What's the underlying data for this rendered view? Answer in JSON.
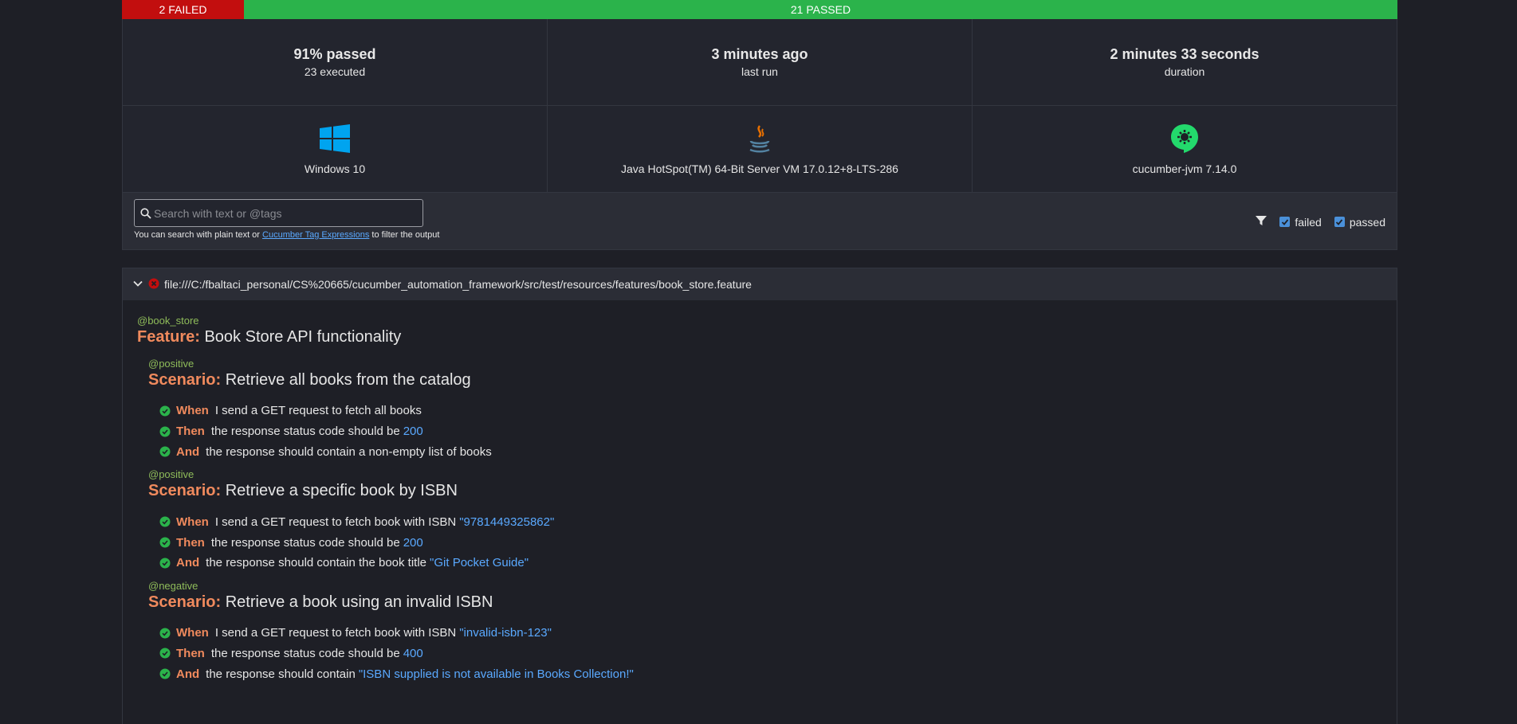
{
  "status": {
    "failed": "2 FAILED",
    "passed": "21 PASSED"
  },
  "stats": {
    "passed_pct": "91% passed",
    "executed": "23 executed",
    "last_run": "3 minutes ago",
    "last_run_label": "last run",
    "duration": "2 minutes 33 seconds",
    "duration_label": "duration"
  },
  "env": {
    "os": "Windows 10",
    "runtime": "Java HotSpot(TM) 64-Bit Server VM 17.0.12+8-LTS-286",
    "framework": "cucumber-jvm 7.14.0"
  },
  "search": {
    "placeholder": "Search with text or @tags",
    "hint_prefix": "You can search with plain text or",
    "hint_link": "Cucumber Tag Expressions",
    "hint_suffix": "to filter the output"
  },
  "filters": {
    "failed": "failed",
    "passed": "passed"
  },
  "feature": {
    "path": "file:///C:/fbaltaci_personal/CS%20665/cucumber_automation_framework/src/test/resources/features/book_store.feature",
    "tag": "@book_store",
    "keyword": "Feature:",
    "name": "Book Store API functionality"
  },
  "scenarios": [
    {
      "tag": "@positive",
      "keyword": "Scenario:",
      "name": "Retrieve all books from the catalog",
      "steps": [
        {
          "kw": "When",
          "text": "I send a GET request to fetch all books",
          "arg": ""
        },
        {
          "kw": "Then",
          "text": "the response status code should be",
          "arg": "200"
        },
        {
          "kw": "And",
          "text": "the response should contain a non-empty list of books",
          "arg": ""
        }
      ]
    },
    {
      "tag": "@positive",
      "keyword": "Scenario:",
      "name": "Retrieve a specific book by ISBN",
      "steps": [
        {
          "kw": "When",
          "text": "I send a GET request to fetch book with ISBN",
          "arg": "\"9781449325862\""
        },
        {
          "kw": "Then",
          "text": "the response status code should be",
          "arg": "200"
        },
        {
          "kw": "And",
          "text": "the response should contain the book title",
          "arg": "\"Git Pocket Guide\""
        }
      ]
    },
    {
      "tag": "@negative",
      "keyword": "Scenario:",
      "name": "Retrieve a book using an invalid ISBN",
      "steps": [
        {
          "kw": "When",
          "text": "I send a GET request to fetch book with ISBN",
          "arg": "\"invalid-isbn-123\""
        },
        {
          "kw": "Then",
          "text": "the response status code should be",
          "arg": "400"
        },
        {
          "kw": "And",
          "text": "the response should contain",
          "arg": "\"ISBN supplied is not available in Books Collection!\""
        }
      ]
    }
  ]
}
